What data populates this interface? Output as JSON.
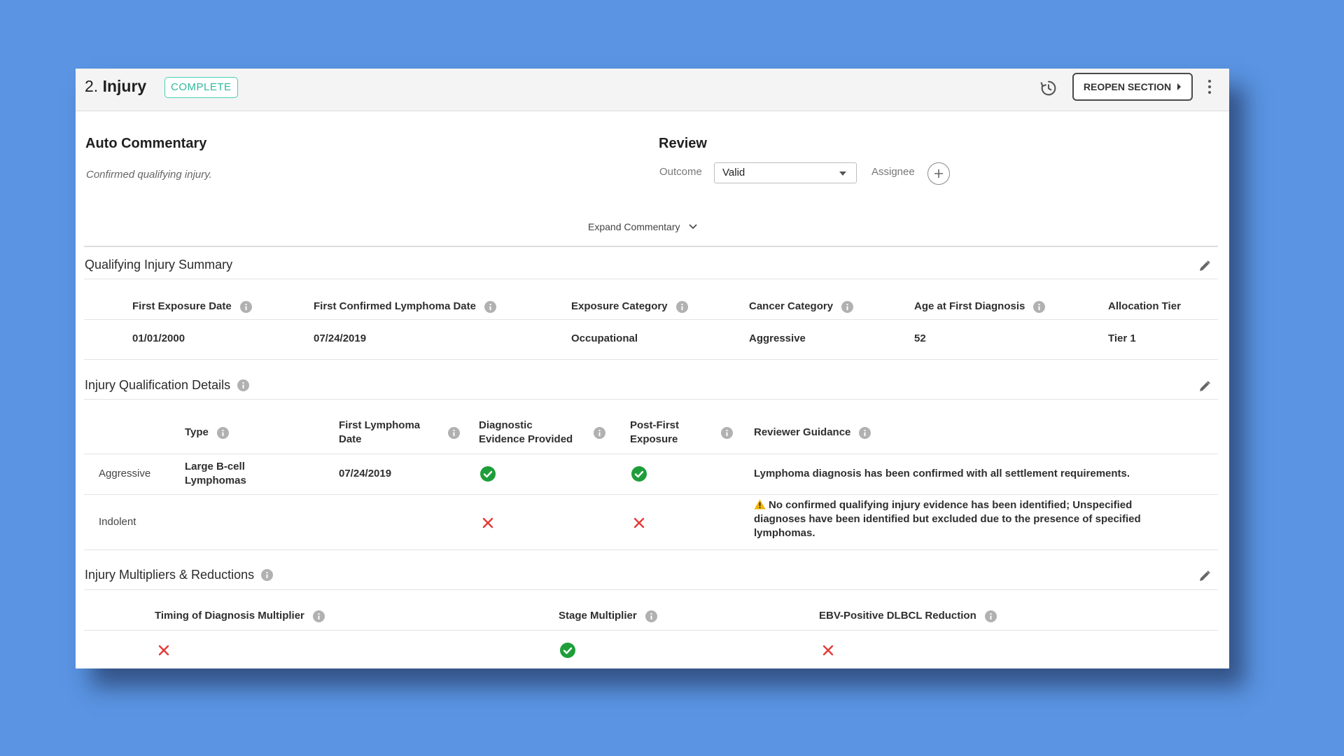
{
  "header": {
    "number": "2.",
    "title": "Injury",
    "status_badge": "COMPLETE",
    "reopen_label": "REOPEN SECTION"
  },
  "auto_commentary": {
    "heading": "Auto Commentary",
    "text": "Confirmed qualifying injury."
  },
  "review": {
    "heading": "Review",
    "outcome_label": "Outcome",
    "outcome_value": "Valid",
    "assignee_label": "Assignee"
  },
  "expand_label": "Expand Commentary",
  "qualifying_summary": {
    "title": "Qualifying Injury Summary",
    "columns": [
      "First Exposure Date",
      "First Confirmed Lymphoma Date",
      "Exposure Category",
      "Cancer Category",
      "Age at First Diagnosis",
      "Allocation Tier"
    ],
    "values": [
      "01/01/2000",
      "07/24/2019",
      "Occupational",
      "Aggressive",
      "52",
      "Tier 1"
    ]
  },
  "qualification_details": {
    "title": "Injury Qualification Details",
    "columns": {
      "type": "Type",
      "first_lymphoma_line1": "First Lymphoma",
      "first_lymphoma_line2": "Date",
      "diagnostic_line1": "Diagnostic",
      "diagnostic_line2": "Evidence Provided",
      "post_first_line1": "Post-First",
      "post_first_line2": "Exposure",
      "guidance": "Reviewer Guidance"
    },
    "rows": [
      {
        "category": "Aggressive",
        "type_line1": "Large B-cell",
        "type_line2": "Lymphomas",
        "first_lymphoma_date": "07/24/2019",
        "diagnostic_evidence": "yes",
        "post_first_exposure": "yes",
        "guidance": "Lymphoma diagnosis has been confirmed with all settlement requirements."
      },
      {
        "category": "Indolent",
        "type_line1": "",
        "type_line2": "",
        "first_lymphoma_date": "",
        "diagnostic_evidence": "no",
        "post_first_exposure": "no",
        "guidance_line1": "No confirmed qualifying injury evidence has been identified; Unspecified",
        "guidance_line2": "diagnoses have been identified but excluded due to the presence of specified",
        "guidance_line3": "lymphomas."
      }
    ]
  },
  "multipliers": {
    "title": "Injury Multipliers & Reductions",
    "columns": [
      "Timing of Diagnosis Multiplier",
      "Stage Multiplier",
      "EBV-Positive DLBCL Reduction"
    ],
    "values": [
      "no",
      "yes",
      "no"
    ]
  },
  "colors": {
    "background": "#5A94E2",
    "badge": "#2fb99d",
    "check": "#1e9e3a",
    "cross": "#e53935",
    "warning": "#f2b400"
  },
  "icons": [
    "history-icon",
    "chevron-right-icon",
    "kebab-icon",
    "plus-icon",
    "chevron-down-icon",
    "edit-icon",
    "info-icon",
    "check-icon",
    "cross-icon",
    "warning-icon"
  ]
}
